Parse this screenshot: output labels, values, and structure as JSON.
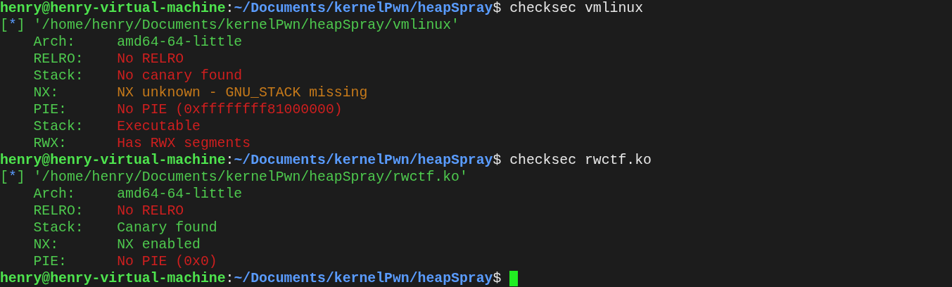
{
  "terminal": {
    "lines": [
      {
        "kind": "prompt",
        "user_host": "henry@henry-virtual-machine",
        "separator": ":",
        "path": "~/Documents/kernelPwn/heapSpray",
        "symbol": "$",
        "command": "checksec vmlinux"
      },
      {
        "kind": "info",
        "open": "[",
        "marker": "*",
        "close": "]",
        "text": "'/home/henry/Documents/kernelPwn/heapSpray/vmlinux'"
      },
      {
        "kind": "field",
        "label": "Arch:",
        "value": "amd64-64-little",
        "color": "#4ec94e"
      },
      {
        "kind": "field",
        "label": "RELRO:",
        "value": "No RELRO",
        "color": "#d01f1f"
      },
      {
        "kind": "field",
        "label": "Stack:",
        "value": "No canary found",
        "color": "#d01f1f"
      },
      {
        "kind": "field",
        "label": "NX:",
        "value": "NX unknown - GNU_STACK missing",
        "color": "#c77a1a"
      },
      {
        "kind": "field",
        "label": "PIE:",
        "value": "No PIE (0xffffffff81000000)",
        "color": "#d01f1f"
      },
      {
        "kind": "field",
        "label": "Stack:",
        "value": "Executable",
        "color": "#d01f1f"
      },
      {
        "kind": "field",
        "label": "RWX:",
        "value": "Has RWX segments",
        "color": "#d01f1f"
      },
      {
        "kind": "prompt",
        "user_host": "henry@henry-virtual-machine",
        "separator": ":",
        "path": "~/Documents/kernelPwn/heapSpray",
        "symbol": "$",
        "command": "checksec rwctf.ko"
      },
      {
        "kind": "info",
        "open": "[",
        "marker": "*",
        "close": "]",
        "text": "'/home/henry/Documents/kernelPwn/heapSpray/rwctf.ko'"
      },
      {
        "kind": "field",
        "label": "Arch:",
        "value": "amd64-64-little",
        "color": "#4ec94e"
      },
      {
        "kind": "field",
        "label": "RELRO:",
        "value": "No RELRO",
        "color": "#d01f1f"
      },
      {
        "kind": "field",
        "label": "Stack:",
        "value": "Canary found",
        "color": "#4ec94e"
      },
      {
        "kind": "field",
        "label": "NX:",
        "value": "NX enabled",
        "color": "#4ec94e"
      },
      {
        "kind": "field",
        "label": "PIE:",
        "value": "No PIE (0x0)",
        "color": "#d01f1f"
      },
      {
        "kind": "prompt",
        "user_host": "henry@henry-virtual-machine",
        "separator": ":",
        "path": "~/Documents/kernelPwn/heapSpray",
        "symbol": "$",
        "cursor": true
      }
    ]
  }
}
